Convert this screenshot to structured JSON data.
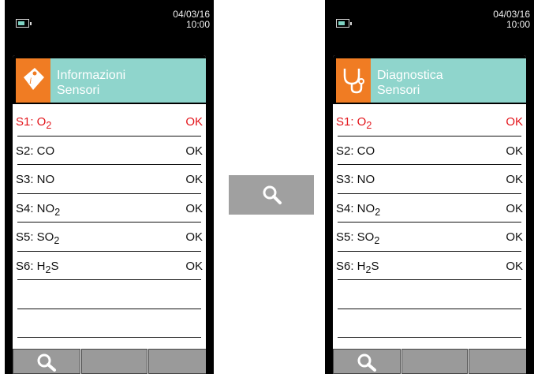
{
  "left": {
    "date": "04/03/16",
    "time": "10:00",
    "title_line1": "Informazioni",
    "title_line2": "Sensori",
    "rows": [
      {
        "label": "S1: O",
        "sub": "2",
        "value": "OK"
      },
      {
        "label": "S2: CO",
        "sub": "",
        "value": "OK"
      },
      {
        "label": "S3: NO",
        "sub": "",
        "value": "OK"
      },
      {
        "label": "S4: NO",
        "sub": "2",
        "value": "OK"
      },
      {
        "label": "S5: SO",
        "sub": "2",
        "value": "OK"
      },
      {
        "label": "S6: H",
        "sub": "2",
        "tail": "S",
        "value": "OK"
      }
    ]
  },
  "right": {
    "date": "04/03/16",
    "time": "10:00",
    "title_line1": "Diagnostica",
    "title_line2": "Sensori",
    "rows": [
      {
        "label": "S1: O",
        "sub": "2",
        "value": "OK"
      },
      {
        "label": "S2: CO",
        "sub": "",
        "value": "OK"
      },
      {
        "label": "S3: NO",
        "sub": "",
        "value": "OK"
      },
      {
        "label": "S4: NO",
        "sub": "2",
        "value": "OK"
      },
      {
        "label": "S5: SO",
        "sub": "2",
        "value": "OK"
      },
      {
        "label": "S6: H",
        "sub": "2",
        "tail": "S",
        "value": "OK"
      }
    ]
  },
  "colors": {
    "accent_orange": "#f07c23",
    "header_teal": "#8fd5cc",
    "selected_red": "#e3151b",
    "softkey_gray": "#9a9a9a"
  },
  "icons": {
    "center": "magnifier-icon",
    "softkey": "magnifier-icon",
    "left_header": "info-tag-icon",
    "right_header": "stethoscope-icon"
  }
}
